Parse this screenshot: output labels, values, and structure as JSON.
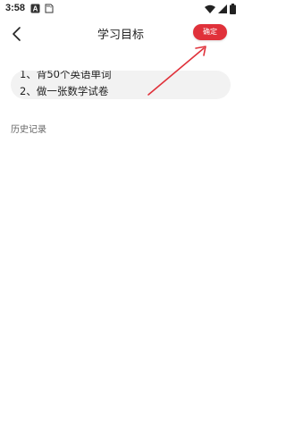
{
  "status_bar": {
    "time": "3:58",
    "icons": [
      "a-badge-icon",
      "sd-card-icon",
      "wifi-icon",
      "signal-icon",
      "battery-icon"
    ]
  },
  "app_bar": {
    "back_icon": "chevron-left-icon",
    "title": "学习目标",
    "confirm_label": "确定"
  },
  "goals": {
    "lines": [
      "1、背50个英语单词",
      "2、做一张数学试卷"
    ]
  },
  "history": {
    "label": "历史记录"
  },
  "colors": {
    "accent": "#e0313a",
    "annotation_arrow": "#e0313a",
    "goal_bg": "#f2f2f2"
  }
}
